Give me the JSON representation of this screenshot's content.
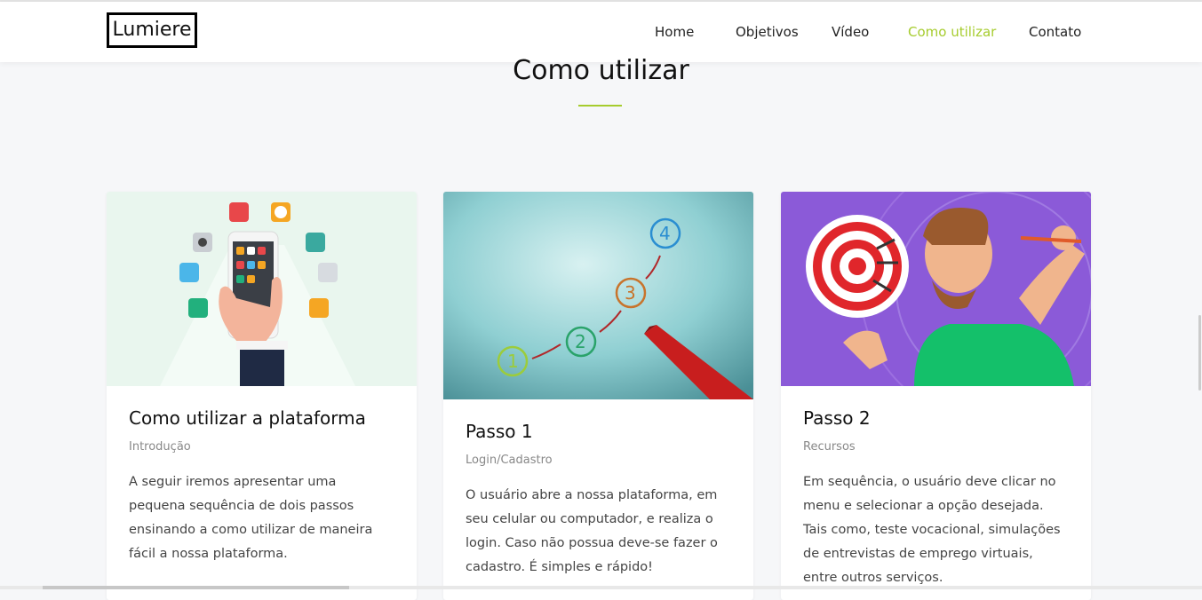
{
  "brand": {
    "logo": "Lumiere"
  },
  "nav": {
    "items": [
      {
        "label": "Home"
      },
      {
        "label": "Objetivos"
      },
      {
        "label": "Vídeo"
      },
      {
        "label": "Como utilizar",
        "active": true
      },
      {
        "label": "Contato"
      }
    ],
    "active_color": "#a6cc2e"
  },
  "section": {
    "title": "Como utilizar"
  },
  "cards": [
    {
      "image": "smartphone-apps-illustration",
      "title": "Como utilizar a plataforma",
      "subtitle": "Introdução",
      "text": "A seguir iremos apresentar uma pequena sequência de dois passos ensinando a como utilizar de maneira fácil a nossa plataforma."
    },
    {
      "image": "numbered-steps-marker-photo",
      "title": "Passo 1",
      "subtitle": "Login/Cadastro",
      "text": "O usuário abre a nossa plataforma, em seu celular ou computador, e realiza o login. Caso não possua deve-se fazer o cadastro. É simples e rápido!"
    },
    {
      "image": "man-throwing-dart-at-target-illustration",
      "title": "Passo 2",
      "subtitle": "Recursos",
      "text": "Em sequência, o usuário deve clicar no menu e selecionar a opção desejada. Tais como, teste vocacional, simulações de entrevistas de emprego virtuais, entre outros serviços."
    }
  ]
}
